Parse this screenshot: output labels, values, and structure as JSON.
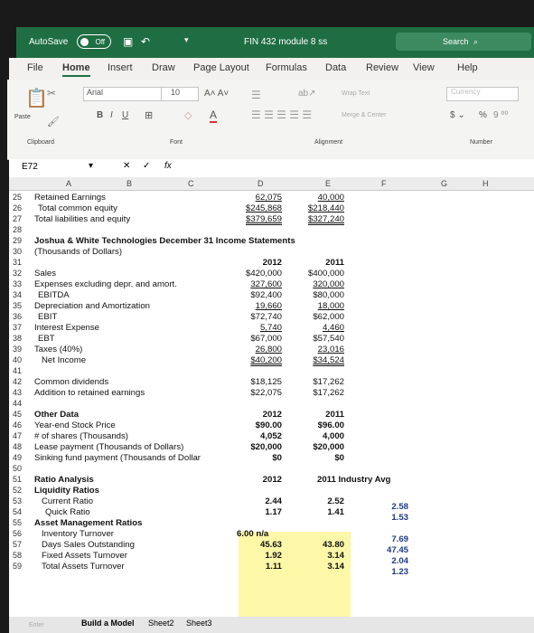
{
  "title": {
    "autosave_label": "AutoSave",
    "toggle": "Off",
    "filename": "FIN 432 module 8 ss",
    "search": "Search"
  },
  "menu": [
    "File",
    "Home",
    "Insert",
    "Draw",
    "Page Layout",
    "Formulas",
    "Data",
    "Review",
    "View",
    "Help"
  ],
  "ribbon": {
    "paste": "Paste",
    "font_name": "Arial",
    "font_size": "10",
    "wrap": "Wrap Text",
    "merge": "Merge & Center",
    "number_format": "Currency",
    "percent": "%",
    "clipboard": "Clipboard",
    "font_group": "Font",
    "alignment": "Alignment",
    "number": "Number",
    "bold": "B",
    "italic": "I",
    "underline": "U"
  },
  "formula": {
    "namebox": "E72",
    "fx": "fx"
  },
  "columns": [
    "A",
    "B",
    "C",
    "D",
    "E",
    "F",
    "G",
    "H"
  ],
  "rows": {
    "r25": {
      "n": "25",
      "a": "Retained Earnings",
      "d": "62,075",
      "e": "40,000"
    },
    "r26": {
      "n": "26",
      "a": "Total common equity",
      "d": "$245,868",
      "e": "$218,440"
    },
    "r27": {
      "n": "27",
      "a": "Total liabilities and equity",
      "d": "$379,659",
      "e": "$327,240"
    },
    "r28": {
      "n": "28"
    },
    "r29": {
      "n": "29",
      "a": "Joshua & White Technologies December 31 Income Statements"
    },
    "r30": {
      "n": "30",
      "a": "(Thousands of Dollars)"
    },
    "r31": {
      "n": "31",
      "d": "2012",
      "e": "2011"
    },
    "r32": {
      "n": "32",
      "a": "Sales",
      "d": "$420,000",
      "e": "$400,000"
    },
    "r33": {
      "n": "33",
      "a": "Expenses excluding depr. and amort.",
      "d": "327,600",
      "e": "320,000"
    },
    "r34": {
      "n": "34",
      "a": "EBITDA",
      "d": "$92,400",
      "e": "$80,000"
    },
    "r35": {
      "n": "35",
      "a": "Depreciation and Amortization",
      "d": "19,660",
      "e": "18,000"
    },
    "r36": {
      "n": "36",
      "a": "EBIT",
      "d": "$72,740",
      "e": "$62,000"
    },
    "r37": {
      "n": "37",
      "a": "Interest Expense",
      "d": "5,740",
      "e": "4,460"
    },
    "r38": {
      "n": "38",
      "a": "EBT",
      "d": "$67,000",
      "e": "$57,540"
    },
    "r39": {
      "n": "39",
      "a": "Taxes (40%)",
      "d": "26,800",
      "e": "23,016"
    },
    "r40": {
      "n": "40",
      "a": "Net Income",
      "d": "$40,200",
      "e": "$34,524"
    },
    "r41": {
      "n": "41"
    },
    "r42": {
      "n": "42",
      "a": "Common dividends",
      "d": "$18,125",
      "e": "$17,262"
    },
    "r43": {
      "n": "43",
      "a": "Addition to retained earnings",
      "d": "$22,075",
      "e": "$17,262"
    },
    "r44": {
      "n": "44"
    },
    "r45": {
      "n": "45",
      "a": "Other Data",
      "d": "2012",
      "e": "2011"
    },
    "r46": {
      "n": "46",
      "a": "Year-end Stock Price",
      "d": "$90.00",
      "e": "$96.00"
    },
    "r47": {
      "n": "47",
      "a": "# of shares (Thousands)",
      "d": "4,052",
      "e": "4,000"
    },
    "r48": {
      "n": "48",
      "a": "Lease payment (Thousands of Dollars)",
      "d": "$20,000",
      "e": "$20,000"
    },
    "r49": {
      "n": "49",
      "a": "Sinking fund payment (Thousands of Dollar",
      "d": "$0",
      "e": "$0"
    },
    "r50": {
      "n": "50"
    },
    "r51": {
      "n": "51",
      "a": "Ratio Analysis",
      "d": "2012",
      "e": "2011 Industry Avg"
    },
    "r52": {
      "n": "52",
      "a": "Liquidity Ratios"
    },
    "r53": {
      "n": "53",
      "a": "Current Ratio",
      "d": "2.44",
      "e": "2.52",
      "f": "2.58"
    },
    "r54": {
      "n": "54",
      "a": "Quick Ratio",
      "d": "1.17",
      "e": "1.41",
      "f": "1.53"
    },
    "r55": {
      "n": "55",
      "a": "Asset Management Ratios"
    },
    "r56": {
      "n": "56",
      "a": "Inventory Turnover",
      "d": "6.00 n/a",
      "f": "7.69"
    },
    "r57": {
      "n": "57",
      "a": "Days Sales Outstanding",
      "d": "45.63",
      "e": "43.80",
      "f": "47.45"
    },
    "r58": {
      "n": "58",
      "a": "Fixed Assets Turnover",
      "d": "1.92",
      "e": "3.14",
      "f": "2.04"
    },
    "r59": {
      "n": "59",
      "a": "Total Assets Turnover",
      "d": "1.11",
      "e": "3.14",
      "f": "1.23"
    }
  },
  "sheets": [
    "Build a Model",
    "Sheet2",
    "Sheet3"
  ],
  "status": "Enter"
}
